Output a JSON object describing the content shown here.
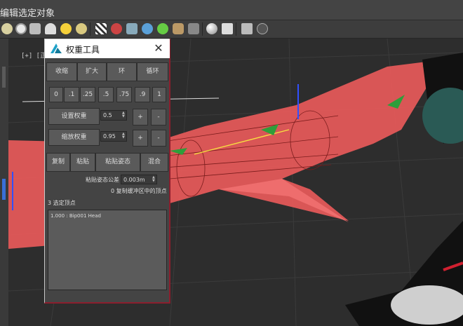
{
  "menubar": {
    "title": "编辑选定对象",
    "tab_a": "",
    "tab_b": ""
  },
  "viewport": {
    "label": "[+] [正交"
  },
  "dialog": {
    "title": "权重工具",
    "row1": [
      "收缩",
      "扩大",
      "环",
      "循环"
    ],
    "presets": [
      "0",
      ".1",
      ".25",
      ".5",
      ".75",
      ".9",
      "1"
    ],
    "set_weight_label": "设置权重",
    "set_weight_value": "0.5",
    "scale_weight_label": "缩放权重",
    "scale_weight_value": "0.95",
    "plus": "+",
    "minus": "-",
    "row4": [
      "复制",
      "粘贴",
      "粘贴姿态",
      "混合"
    ],
    "paste_tolerance_label": "粘贴姿态公差",
    "paste_tolerance_value": "0.003m",
    "copy_buffer_status": "0 复制缓冲区中的顶点",
    "selected_count": "3 选定顶点",
    "list_items": [
      "1.000 : Bip001 Head"
    ]
  },
  "colors": {
    "mesh_red": "#e85a5a",
    "dialog_border": "#8b1e2d",
    "accent_logo": "#1da1c8"
  },
  "icons": [
    "teapot-icon",
    "sphere-icon",
    "light-icon",
    "sun-icon",
    "checker-icon",
    "render-icon",
    "help-icon"
  ]
}
